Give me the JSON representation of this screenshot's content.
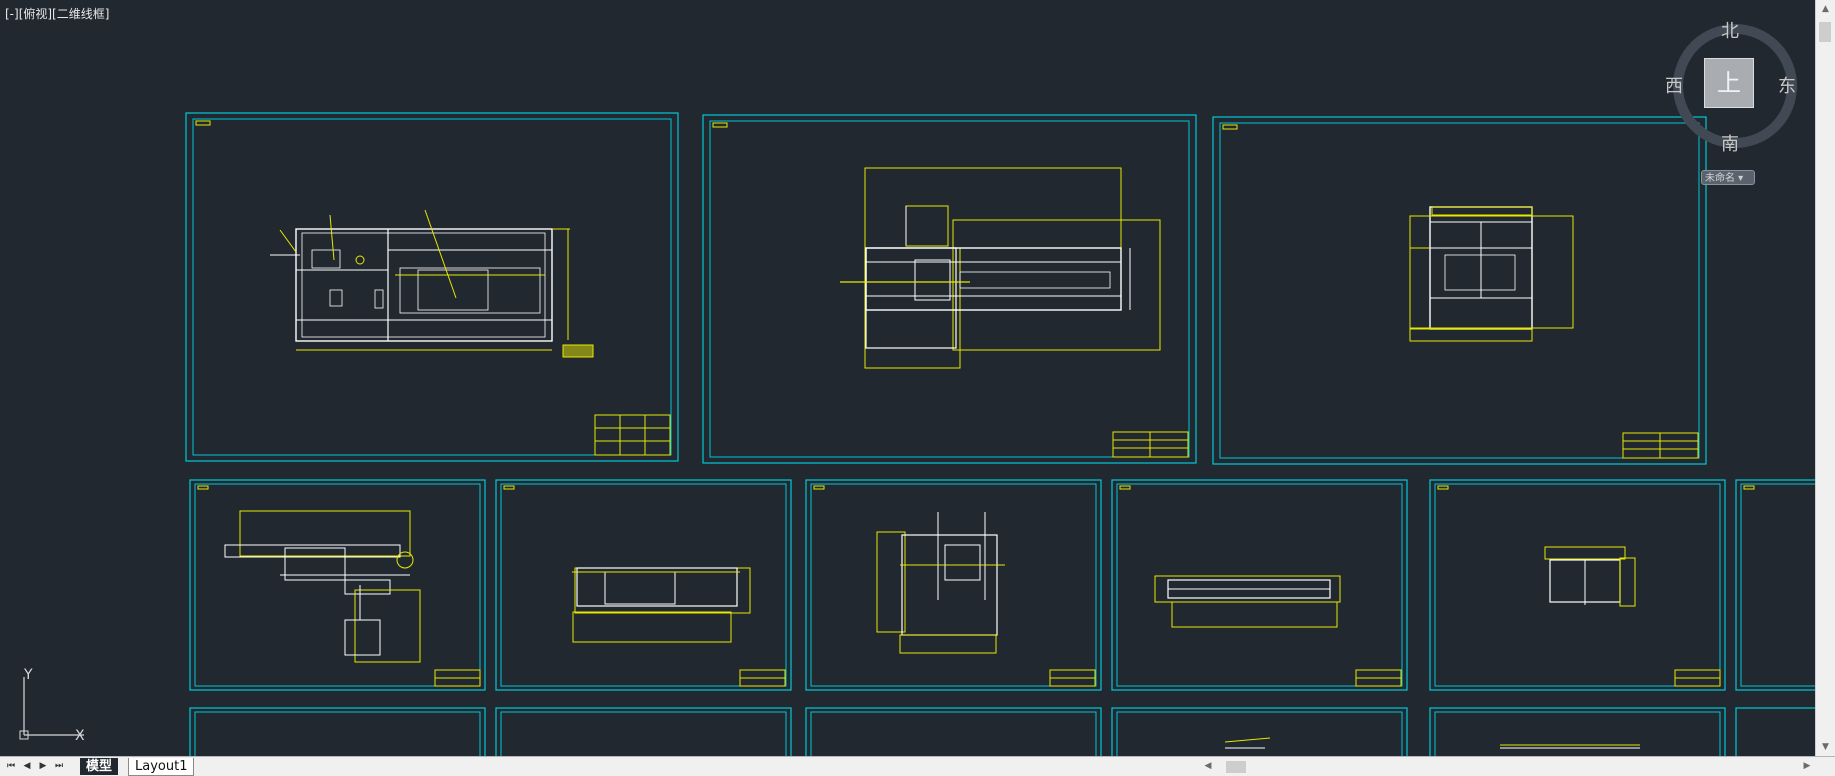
{
  "viewport": {
    "label": "[-][俯视][二维线框]"
  },
  "viewcube": {
    "north": "北",
    "south": "南",
    "west": "西",
    "east": "东",
    "face": "上",
    "wcs_menu": "未命名 ▾"
  },
  "ucs": {
    "x_label": "X",
    "y_label": "Y"
  },
  "layout_tabs": {
    "model": "模型",
    "layout1": "Layout1"
  },
  "navigation": {
    "first": "⏮",
    "prev": "◀",
    "next": "▶",
    "last": "⏭"
  },
  "colors": {
    "background": "#212830",
    "frame": "#00c8d8",
    "dimension": "#e8e800",
    "geometry": "#ffffff"
  }
}
